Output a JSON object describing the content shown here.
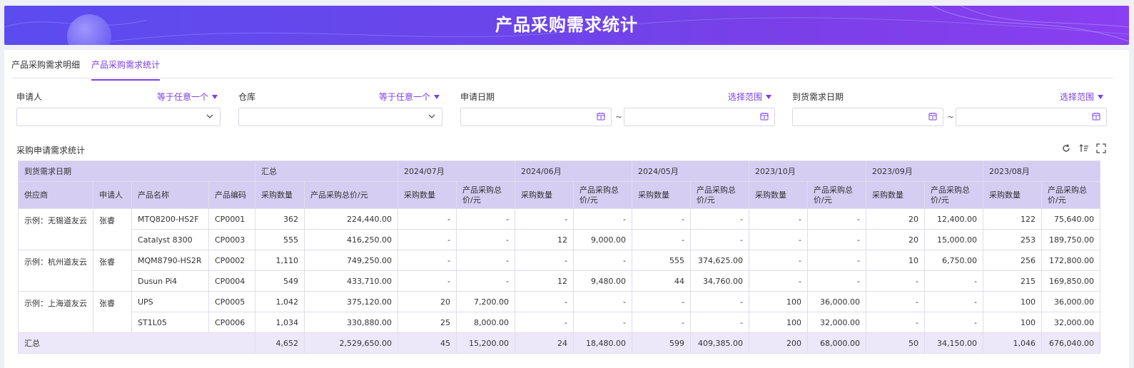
{
  "banner": {
    "title": "产品采购需求统计"
  },
  "tabs": [
    {
      "label": "产品采购需求明细"
    },
    {
      "label": "产品采购需求统计"
    }
  ],
  "filters": {
    "applicant": {
      "label": "申请人",
      "op": "等于任意一个"
    },
    "warehouse": {
      "label": "仓库",
      "op": "等于任意一个"
    },
    "apply_date": {
      "label": "申请日期",
      "op": "选择范围"
    },
    "arrival_date": {
      "label": "到货需求日期",
      "op": "选择范围"
    },
    "range_sep": "~"
  },
  "section": {
    "title": "采购申请需求统计"
  },
  "table": {
    "group_header": "到货需求日期",
    "total_header": "汇总",
    "months": [
      "2024/07月",
      "2024/06月",
      "2024/05月",
      "2023/10月",
      "2023/09月",
      "2023/08月"
    ],
    "columns": [
      "供应商",
      "申请人",
      "产品名称",
      "产品编码"
    ],
    "qty_header": "采购数量",
    "amt_header": "产品采购总价/元",
    "amt_header_wrapped": "产品采购总价/元",
    "rows": [
      {
        "supplier": "示例：无锡道友云",
        "applicant": "张睿",
        "product": "MTQ8200-HS2F",
        "code": "CP0001",
        "vals": [
          "362",
          "224,440.00",
          "-",
          "-",
          "-",
          "-",
          "-",
          "-",
          "-",
          "-",
          "20",
          "12,400.00",
          "122",
          "75,640.00"
        ]
      },
      {
        "supplier": "",
        "applicant": "",
        "product": "Catalyst 8300",
        "code": "CP0003",
        "vals": [
          "555",
          "416,250.00",
          "-",
          "-",
          "12",
          "9,000.00",
          "-",
          "-",
          "-",
          "-",
          "20",
          "15,000.00",
          "253",
          "189,750.00"
        ]
      },
      {
        "supplier": "示例：杭州道友云",
        "applicant": "张睿",
        "product": "MQM8790-HS2R",
        "code": "CP0002",
        "vals": [
          "1,110",
          "749,250.00",
          "-",
          "-",
          "-",
          "-",
          "555",
          "374,625.00",
          "-",
          "-",
          "10",
          "6,750.00",
          "256",
          "172,800.00"
        ]
      },
      {
        "supplier": "",
        "applicant": "",
        "product": "Dusun Pi4",
        "code": "CP0004",
        "vals": [
          "549",
          "433,710.00",
          "-",
          "-",
          "12",
          "9,480.00",
          "44",
          "34,760.00",
          "-",
          "-",
          "-",
          "-",
          "215",
          "169,850.00"
        ]
      },
      {
        "supplier": "示例：上海道友云",
        "applicant": "张睿",
        "product": "UPS",
        "code": "CP0005",
        "vals": [
          "1,042",
          "375,120.00",
          "20",
          "7,200.00",
          "-",
          "-",
          "-",
          "-",
          "100",
          "36,000.00",
          "-",
          "-",
          "100",
          "36,000.00"
        ]
      },
      {
        "supplier": "",
        "applicant": "",
        "product": "ST1L05",
        "code": "CP0006",
        "vals": [
          "1,034",
          "330,880.00",
          "25",
          "8,000.00",
          "-",
          "-",
          "-",
          "-",
          "100",
          "32,000.00",
          "-",
          "-",
          "100",
          "32,000.00"
        ]
      }
    ],
    "total_row": {
      "label": "汇总",
      "vals": [
        "4,652",
        "2,529,650.00",
        "45",
        "15,200.00",
        "24",
        "18,480.00",
        "599",
        "409,385.00",
        "200",
        "68,000.00",
        "50",
        "34,150.00",
        "1,046",
        "676,040.00"
      ]
    }
  },
  "colors": {
    "accent": "#7a3fe8",
    "header_bg": "#d6cdf3",
    "sub_bg": "#ece8f9"
  }
}
